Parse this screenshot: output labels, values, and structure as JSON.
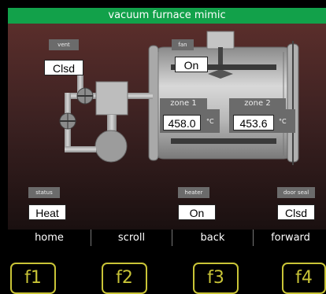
{
  "title": "vacuum furnace mimic",
  "labels": {
    "vent": "vent",
    "fan": "fan",
    "zone1": "zone 1",
    "zone2": "zone 2",
    "status": "status",
    "heater": "heater",
    "door_seal": "door seal"
  },
  "values": {
    "vent": "Clsd",
    "fan": "On",
    "zone1_temp": "458.0",
    "zone2_temp": "453.6",
    "status": "Heat",
    "heater": "On",
    "door_seal": "Clsd"
  },
  "units": {
    "zone1": "°C",
    "zone2": "°C"
  },
  "nav": {
    "home": "home",
    "scroll": "scroll",
    "back": "back",
    "forward": "forward"
  },
  "fkeys": {
    "f1": "f1",
    "f2": "f2",
    "f3": "f3",
    "f4": "f4"
  },
  "colors": {
    "title_bar": "#12a14a",
    "fkey_outline": "#c9c437",
    "background_top": "#5a2e2b",
    "background_bottom": "#1a1010"
  }
}
